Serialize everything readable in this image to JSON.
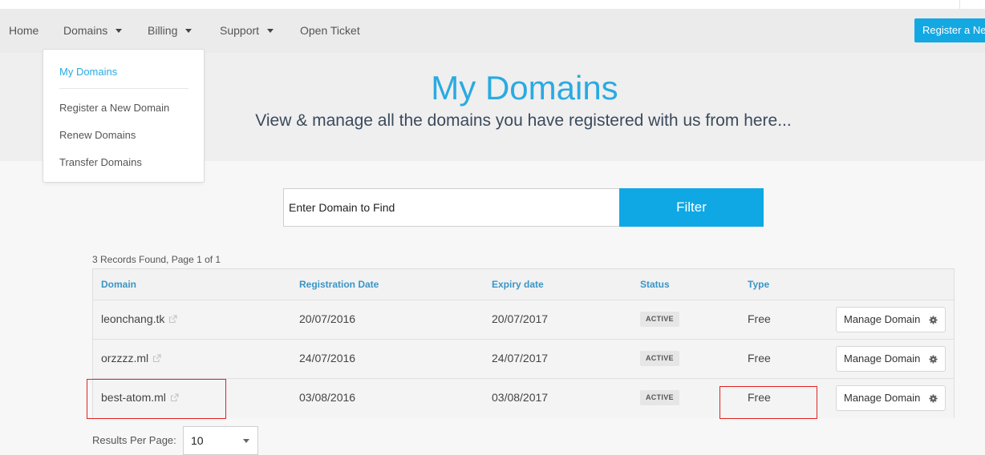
{
  "nav": {
    "home": "Home",
    "domains": "Domains",
    "billing": "Billing",
    "support": "Support",
    "open_ticket": "Open Ticket",
    "register_button": "Register a New Domain"
  },
  "dropdown": {
    "items": [
      {
        "label": "My Domains",
        "active": true
      },
      {
        "label": "Register a New Domain"
      },
      {
        "label": "Renew Domains"
      },
      {
        "label": "Transfer Domains"
      }
    ]
  },
  "hero": {
    "title": "My Domains",
    "subtitle": "View & manage all the domains you have registered with us from here..."
  },
  "search": {
    "value": "Enter Domain to Find",
    "filter_label": "Filter"
  },
  "records_text": "3 Records Found, Page 1 of 1",
  "table": {
    "headers": {
      "domain": "Domain",
      "registration_date": "Registration Date",
      "expiry_date": "Expiry date",
      "status": "Status",
      "type": "Type"
    },
    "rows": [
      {
        "domain": "leonchang.tk",
        "registration_date": "20/07/2016",
        "expiry_date": "20/07/2017",
        "status": "ACTIVE",
        "type": "Free",
        "action": "Manage Domain"
      },
      {
        "domain": "orzzzz.ml",
        "registration_date": "24/07/2016",
        "expiry_date": "24/07/2017",
        "status": "ACTIVE",
        "type": "Free",
        "action": "Manage Domain"
      },
      {
        "domain": "best-atom.ml",
        "registration_date": "03/08/2016",
        "expiry_date": "03/08/2017",
        "status": "ACTIVE",
        "type": "Free",
        "action": "Manage Domain"
      }
    ]
  },
  "results_per_page": {
    "label": "Results Per Page:",
    "value": "10"
  },
  "colors": {
    "accent": "#2aaae2",
    "button": "#0fa8e5",
    "header_text": "#3a95c8",
    "highlight": "#e02222"
  }
}
